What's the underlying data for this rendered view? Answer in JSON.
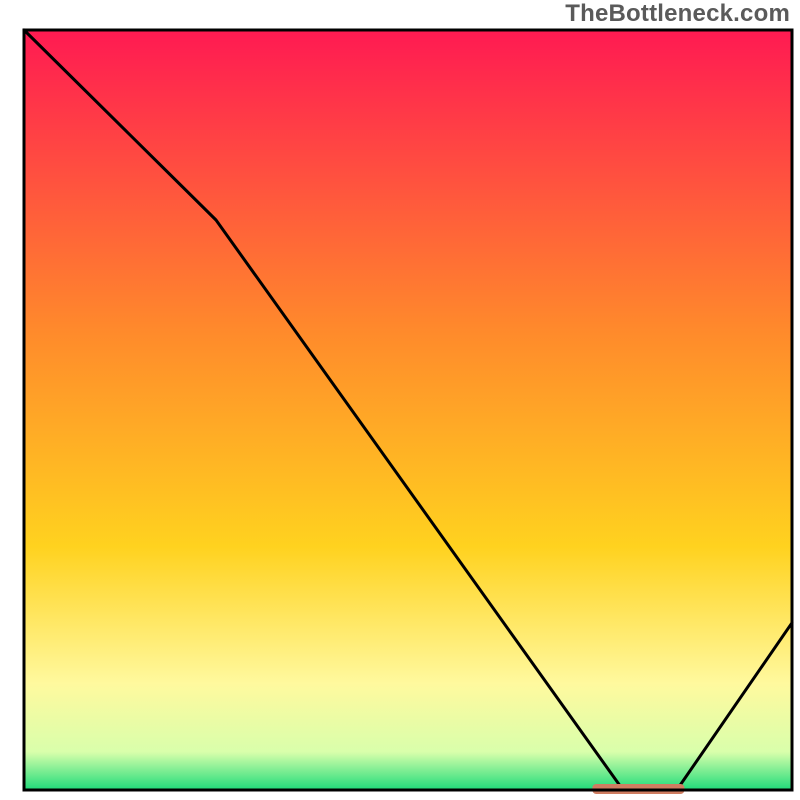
{
  "attribution": "TheBottleneck.com",
  "colors": {
    "gradient_top": "#ff1a52",
    "gradient_mid1": "#ff8b2b",
    "gradient_mid2": "#ffd21f",
    "gradient_mid3": "#fff99e",
    "gradient_bottom": "#1fdb7a",
    "curve": "#000000",
    "marker": "#cf7d61",
    "frame": "#000000"
  },
  "chart_data": {
    "type": "line",
    "title": "",
    "xlabel": "",
    "ylabel": "",
    "xlim": [
      0,
      100
    ],
    "ylim": [
      0,
      100
    ],
    "x": [
      0,
      22,
      78,
      85,
      100
    ],
    "values": [
      100,
      78,
      0,
      0,
      22
    ],
    "marker_segment": {
      "x_start": 74,
      "x_end": 86,
      "y": 0
    }
  }
}
